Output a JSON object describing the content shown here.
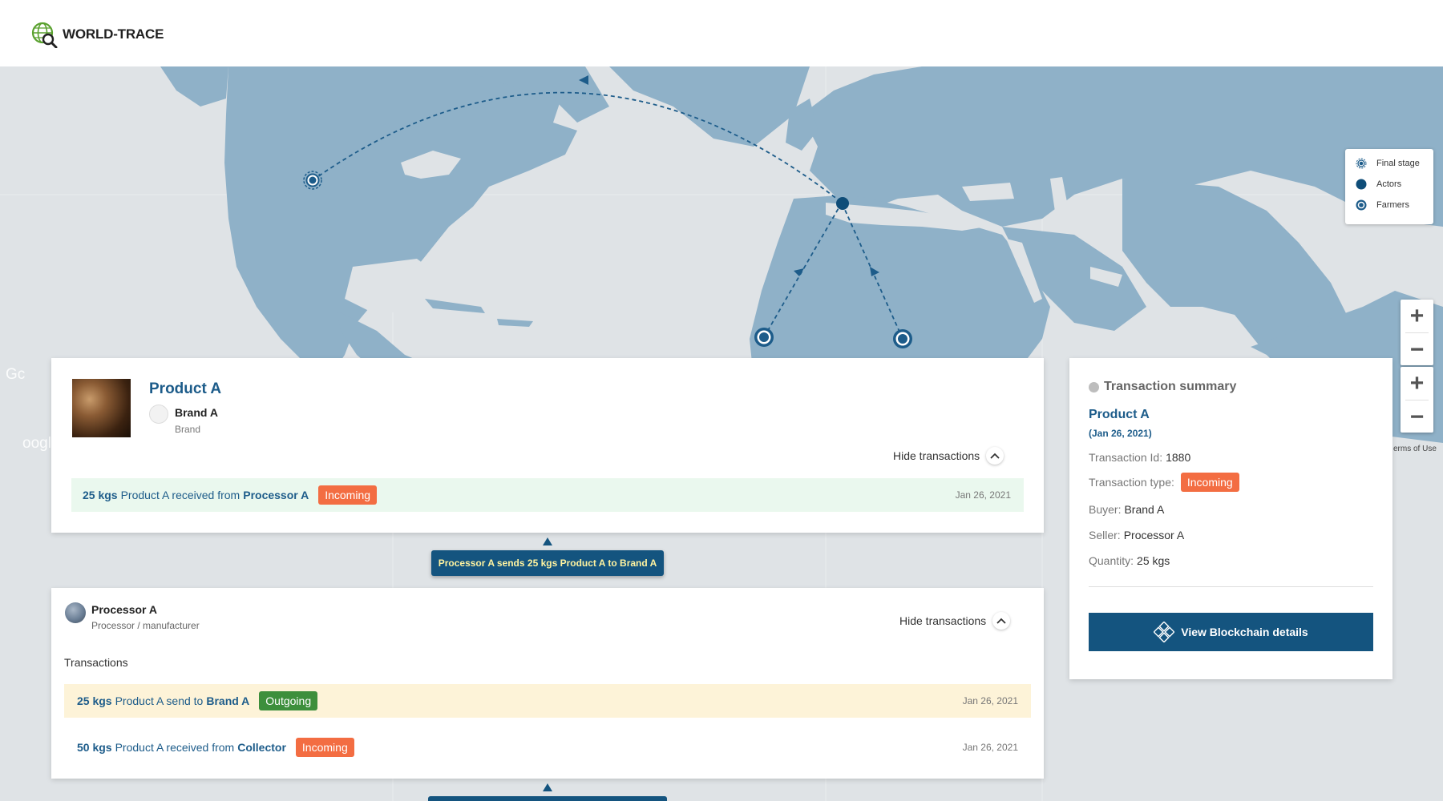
{
  "app": {
    "logo_text": "WORLD-TRACE"
  },
  "map": {
    "legend": [
      {
        "label": "Final stage",
        "icon": "final-stage-marker-icon"
      },
      {
        "label": "Actors",
        "icon": "actor-marker-icon"
      },
      {
        "label": "Farmers",
        "icon": "farmer-marker-icon"
      }
    ],
    "zoom_in": "+",
    "zoom_out": "−",
    "attribution_terms": "erms of Use",
    "google_fragment_1": "Gc",
    "google_fragment_2": "oogl",
    "colors": {
      "land": "#8fb1c8",
      "water": "#dfe3e6",
      "route": "#1d5c8a"
    }
  },
  "product_card": {
    "title": "Product A",
    "brand_name": "Brand A",
    "brand_role": "Brand",
    "hide_label": "Hide transactions",
    "transactions": [
      {
        "qty": "25 kgs",
        "text_before": "Product A received from",
        "party": "Processor A",
        "badge": "Incoming",
        "date": "Jan 26, 2021"
      }
    ]
  },
  "flow_label": "Processor A sends 25 kgs Product A to Brand A",
  "processor_card": {
    "name": "Processor A",
    "role": "Processor / manufacturer",
    "hide_label": "Hide transactions",
    "heading": "Transactions",
    "transactions": [
      {
        "qty": "25 kgs",
        "text_before": "Product A send to",
        "party": "Brand A",
        "badge": "Outgoing",
        "date": "Jan 26, 2021"
      },
      {
        "qty": "50 kgs",
        "text_before": "Product A received from",
        "party": "Collector",
        "badge": "Incoming",
        "date": "Jan 26, 2021"
      }
    ]
  },
  "summary": {
    "title": "Transaction summary",
    "product": "Product A",
    "date": "(Jan 26, 2021)",
    "tx_id_label": "Transaction Id:",
    "tx_id": "1880",
    "type_label": "Transaction type:",
    "type": "Incoming",
    "buyer_label": "Buyer:",
    "buyer": "Brand A",
    "seller_label": "Seller:",
    "seller": "Processor A",
    "quantity_label": "Quantity:",
    "quantity": "25 kgs",
    "button_label": "View Blockchain details"
  }
}
